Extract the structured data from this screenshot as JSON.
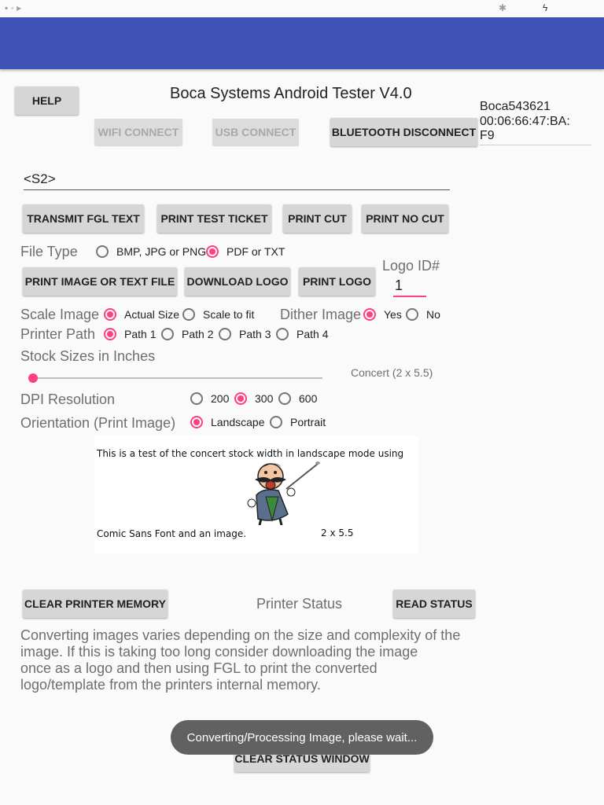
{
  "app": {
    "title": "Boca Systems Android Tester V4.0"
  },
  "device": {
    "line1": "Boca543621",
    "line2": "00:06:66:47:BA:",
    "line3": "F9"
  },
  "buttons": {
    "help": "HELP",
    "wifi_connect": "WIFI CONNECT",
    "usb_connect": "USB CONNECT",
    "bluetooth_disconnect": "BLUETOOTH DISCONNECT",
    "transmit_fgl": "TRANSMIT FGL TEXT",
    "print_test_ticket": "PRINT TEST TICKET",
    "print_cut": "PRINT CUT",
    "print_no_cut": "PRINT NO CUT",
    "print_image_or_text": "PRINT IMAGE OR TEXT FILE",
    "download_logo": "DOWNLOAD LOGO",
    "print_logo": "PRINT LOGO",
    "clear_printer_memory": "CLEAR PRINTER MEMORY",
    "read_status": "READ STATUS",
    "clear_status_window": "CLEAR STATUS WINDOW"
  },
  "fgl_input": {
    "value": "<S2>"
  },
  "file_type": {
    "label": "File Type",
    "options": [
      "BMP, JPG or PNG",
      "PDF or TXT"
    ],
    "selected": 1
  },
  "logo": {
    "label": "Logo ID#",
    "value": "1"
  },
  "scale_image": {
    "label": "Scale Image",
    "options": [
      "Actual Size",
      "Scale to fit"
    ],
    "selected": 0
  },
  "dither_image": {
    "label": "Dither Image",
    "options": [
      "Yes",
      "No"
    ],
    "selected": 0
  },
  "printer_path": {
    "label": "Printer Path",
    "options": [
      "Path 1",
      "Path 2",
      "Path 3",
      "Path 4"
    ],
    "selected": 0
  },
  "stock_sizes": {
    "label": "Stock Sizes in Inches",
    "value_label": "Concert (2 x 5.5)",
    "slider_fraction": 0
  },
  "dpi": {
    "label": "DPI Resolution",
    "options": [
      "200",
      "300",
      "600"
    ],
    "selected": 1
  },
  "orientation": {
    "label": "Orientation (Print Image)",
    "options": [
      "Landscape",
      "Portrait"
    ],
    "selected": 0
  },
  "preview": {
    "line1": "This is a test of the concert stock width in landscape mode using",
    "line2": "Comic Sans Font and an image.",
    "size": "2 x 5.5"
  },
  "printer_status": {
    "label": "Printer Status"
  },
  "info_text": {
    "line1": "Converting images varies depending on the size and complexity of the",
    "line2": "image. If this is taking too long consider downloading the image",
    "line3": "once as a logo and then using FGL to print the converted",
    "line4": "logo/template from the printers internal memory."
  },
  "toast": {
    "text": "Converting/Processing Image, please wait..."
  },
  "colors": {
    "app_bar": "#3f51b5",
    "accent": "#ff4081",
    "button": "#d6d6d6"
  }
}
